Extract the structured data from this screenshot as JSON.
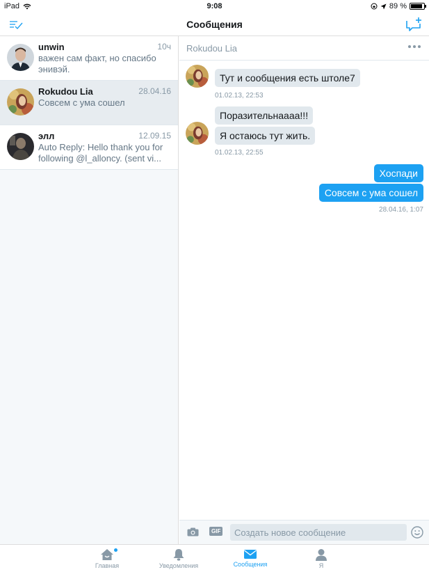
{
  "status": {
    "device": "iPad",
    "time": "9:08",
    "battery_pct": "89 %",
    "battery_level": 0.89
  },
  "nav": {
    "title": "Сообщения"
  },
  "conversations": [
    {
      "name": "unwin",
      "date": "10ч",
      "preview": "важен сам факт, но спасибо\nэнивэй."
    },
    {
      "name": "Rokudou Lia",
      "date": "28.04.16",
      "preview": "Совсем с ума сошел"
    },
    {
      "name": "элл",
      "date": "12.09.15",
      "preview": "Auto Reply: Hello thank you for\nfollowing @l_allоncy. (sent vi..."
    }
  ],
  "chat": {
    "header": "Rokudou Lia",
    "messages": [
      {
        "dir": "in",
        "text": "Тут и сообщения есть штоле7"
      },
      {
        "dir": "in",
        "text": "Поразительнаааа!!!"
      },
      {
        "dir": "in",
        "text": "Я остаюсь тут жить."
      },
      {
        "dir": "out",
        "text": "Хоспади"
      },
      {
        "dir": "out",
        "text": "Совсем с ума сошел"
      }
    ],
    "timestamps": [
      "01.02.13, 22:53",
      "01.02.13, 22:55",
      "28.04.16, 1:07"
    ]
  },
  "compose": {
    "gif": "GIF",
    "placeholder": "Создать новое сообщение"
  },
  "tabs": [
    {
      "label": "Главная"
    },
    {
      "label": "Уведомления"
    },
    {
      "label": "Сообщения"
    },
    {
      "label": "Я"
    }
  ],
  "colors": {
    "accent": "#1da1f2",
    "incoming": "#e1e8ed",
    "muted": "#8899a6"
  },
  "icons": [
    "wifi-icon",
    "lock-rotation-icon",
    "location-arrow-icon",
    "battery-icon",
    "edit-checklist-icon",
    "new-message-icon",
    "more-icon",
    "camera-icon",
    "emoji-icon",
    "home-icon",
    "bell-icon",
    "envelope-icon",
    "person-icon"
  ]
}
